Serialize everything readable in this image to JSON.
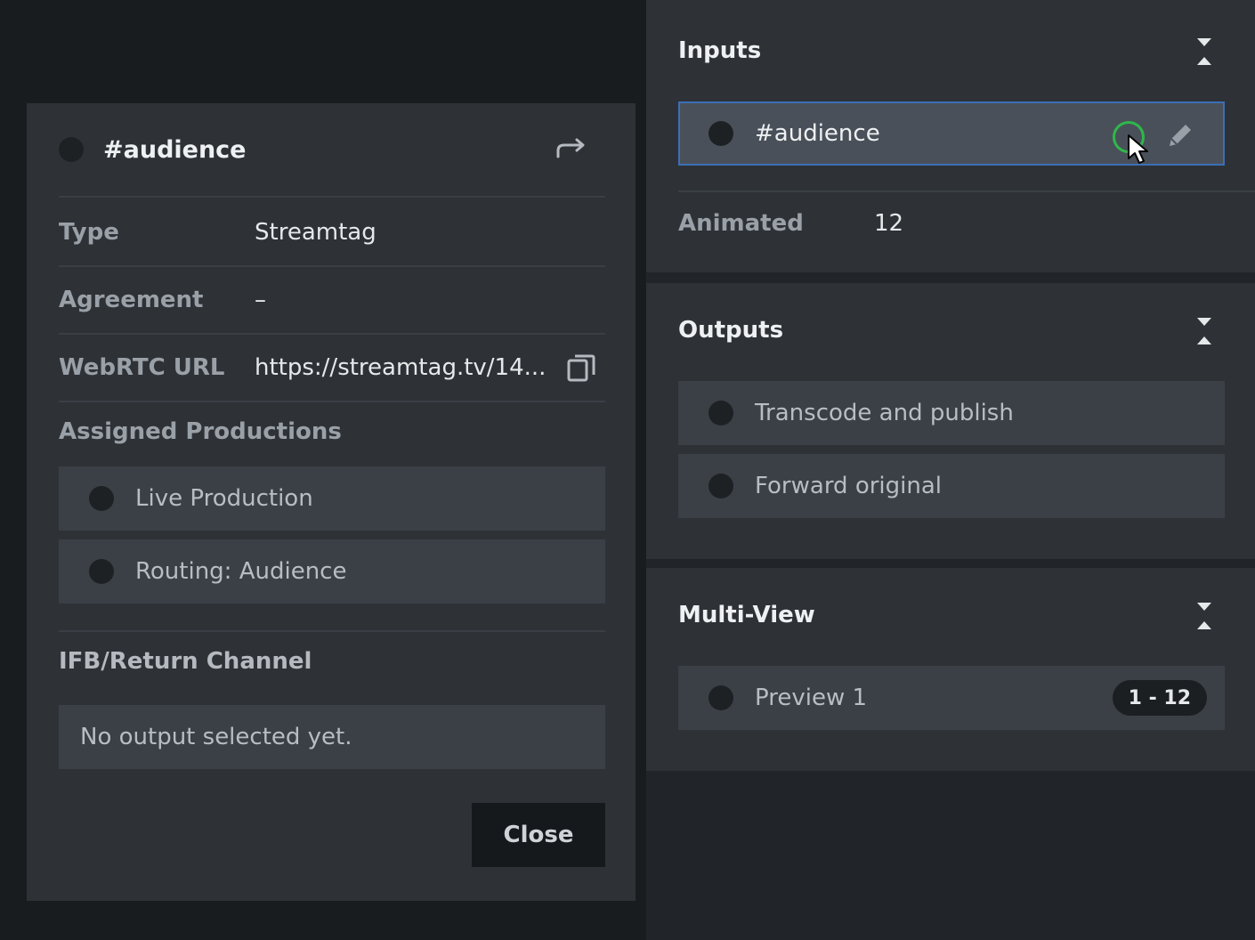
{
  "modal": {
    "title": "#audience",
    "icons": {
      "status": "status-dot-icon",
      "share": "share-arrow-icon",
      "copy": "copy-icon"
    },
    "rows": [
      {
        "label": "Type",
        "value": "Streamtag"
      },
      {
        "label": "Agreement",
        "value": "–"
      },
      {
        "label": "WebRTC URL",
        "value": "https://streamtag.tv/14..."
      }
    ],
    "assigned_heading": "Assigned Productions",
    "productions": [
      {
        "label": "Live Production"
      },
      {
        "label": "Routing: Audience"
      }
    ],
    "ifb_heading": "IFB/Return Channel",
    "ifb_empty": "No output selected yet.",
    "close_label": "Close"
  },
  "inputs": {
    "title": "Inputs",
    "item_label": "#audience",
    "meta_label": "Animated",
    "meta_value": "12",
    "icons": {
      "collapse": "collapse-expand-icon",
      "edit": "pencil-icon",
      "live": "live-ring-icon",
      "cursor": "mouse-cursor-icon"
    }
  },
  "outputs": {
    "title": "Outputs",
    "items": [
      {
        "label": "Transcode and publish"
      },
      {
        "label": "Forward original"
      }
    ]
  },
  "multiview": {
    "title": "Multi-View",
    "item_label": "Preview 1",
    "badge": "1 - 12"
  },
  "colors": {
    "accent_border": "#3b6fb6",
    "live_green": "#2eb84a",
    "panel": "#2e3237",
    "item_bg": "#3b4047"
  }
}
